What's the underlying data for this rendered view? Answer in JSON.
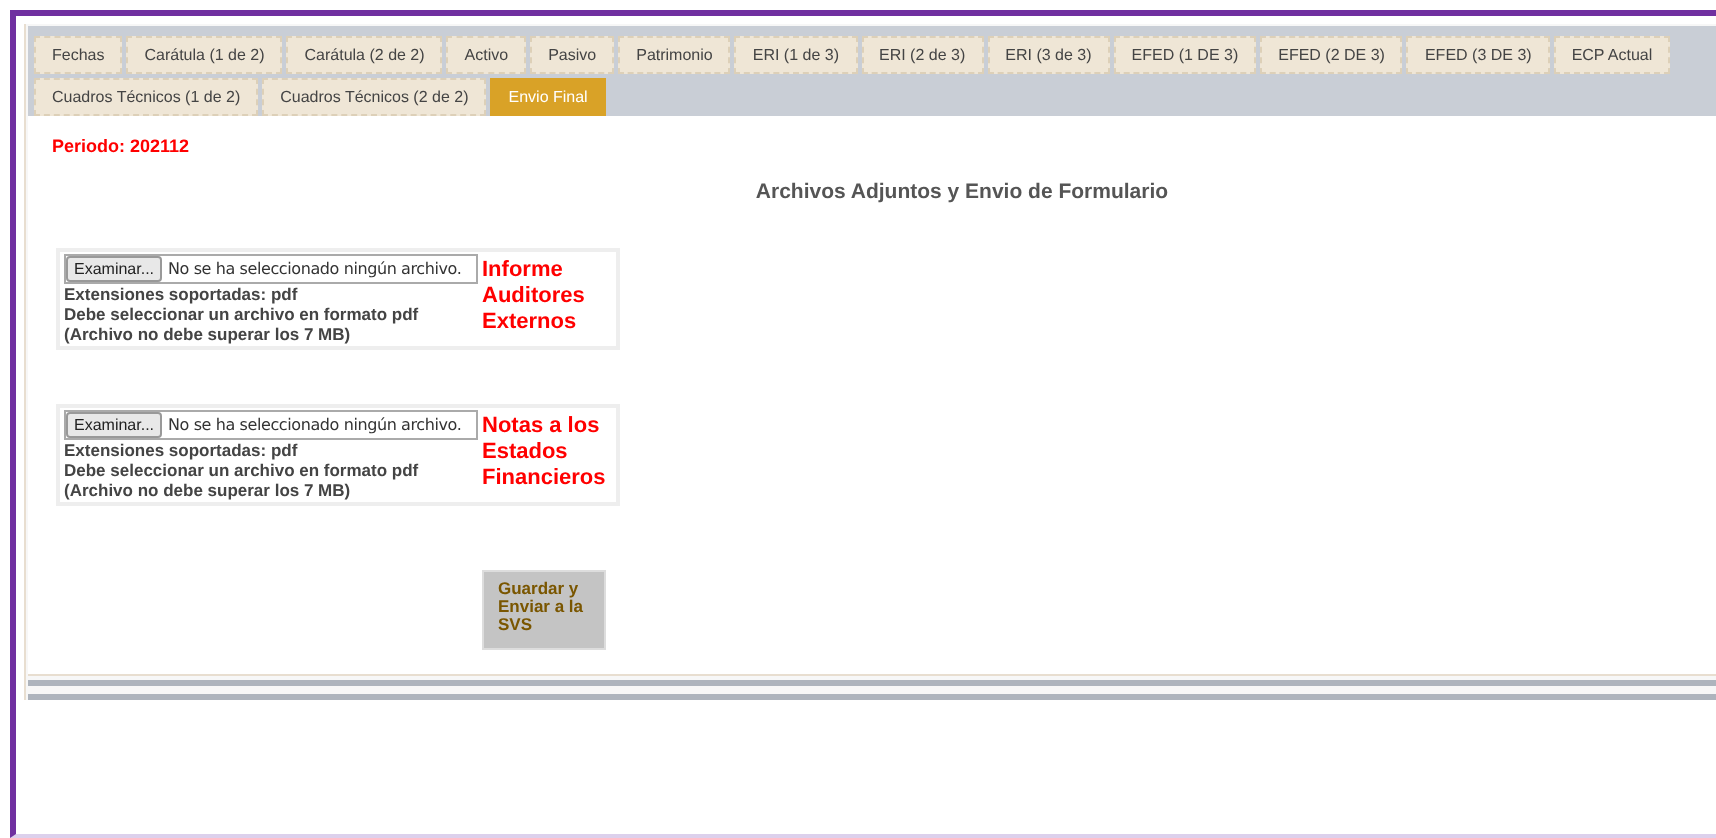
{
  "tabs": [
    {
      "label": "Fechas",
      "selected": false
    },
    {
      "label": "Carátula (1 de 2)",
      "selected": false
    },
    {
      "label": "Carátula (2 de 2)",
      "selected": false
    },
    {
      "label": "Activo",
      "selected": false
    },
    {
      "label": "Pasivo",
      "selected": false
    },
    {
      "label": "Patrimonio",
      "selected": false
    },
    {
      "label": "ERI (1 de 3)",
      "selected": false
    },
    {
      "label": "ERI (2 de 3)",
      "selected": false
    },
    {
      "label": "ERI (3 de 3)",
      "selected": false
    },
    {
      "label": "EFED (1 DE 3)",
      "selected": false
    },
    {
      "label": "EFED (2 DE 3)",
      "selected": false
    },
    {
      "label": "EFED (3 DE 3)",
      "selected": false
    },
    {
      "label": "ECP Actual",
      "selected": false
    },
    {
      "label": "Cuadros Técnicos (1 de 2)",
      "selected": false
    },
    {
      "label": "Cuadros Técnicos (2 de 2)",
      "selected": false
    },
    {
      "label": "Envio Final",
      "selected": true
    }
  ],
  "period": "Periodo: 202112",
  "heading": "Archivos Adjuntos y Envio de Formulario",
  "uploads": [
    {
      "browse": "Examinar...",
      "file_status": "No se ha seleccionado ningún archivo.",
      "notes": [
        "Extensiones soportadas: pdf",
        "Debe seleccionar un archivo en formato pdf",
        "(Archivo no debe superar los 7 MB)"
      ],
      "title": [
        "Informe",
        "Auditores",
        "Externos"
      ]
    },
    {
      "browse": "Examinar...",
      "file_status": "No se ha seleccionado ningún archivo.",
      "notes": [
        "Extensiones soportadas: pdf",
        "Debe seleccionar un archivo en formato pdf",
        "(Archivo no debe superar los 7 MB)"
      ],
      "title": [
        "Notas a los",
        "Estados",
        "Financieros"
      ]
    }
  ],
  "submit": {
    "lines": [
      "Guardar y",
      "Enviar a la",
      "SVS"
    ],
    "disabled": true
  }
}
